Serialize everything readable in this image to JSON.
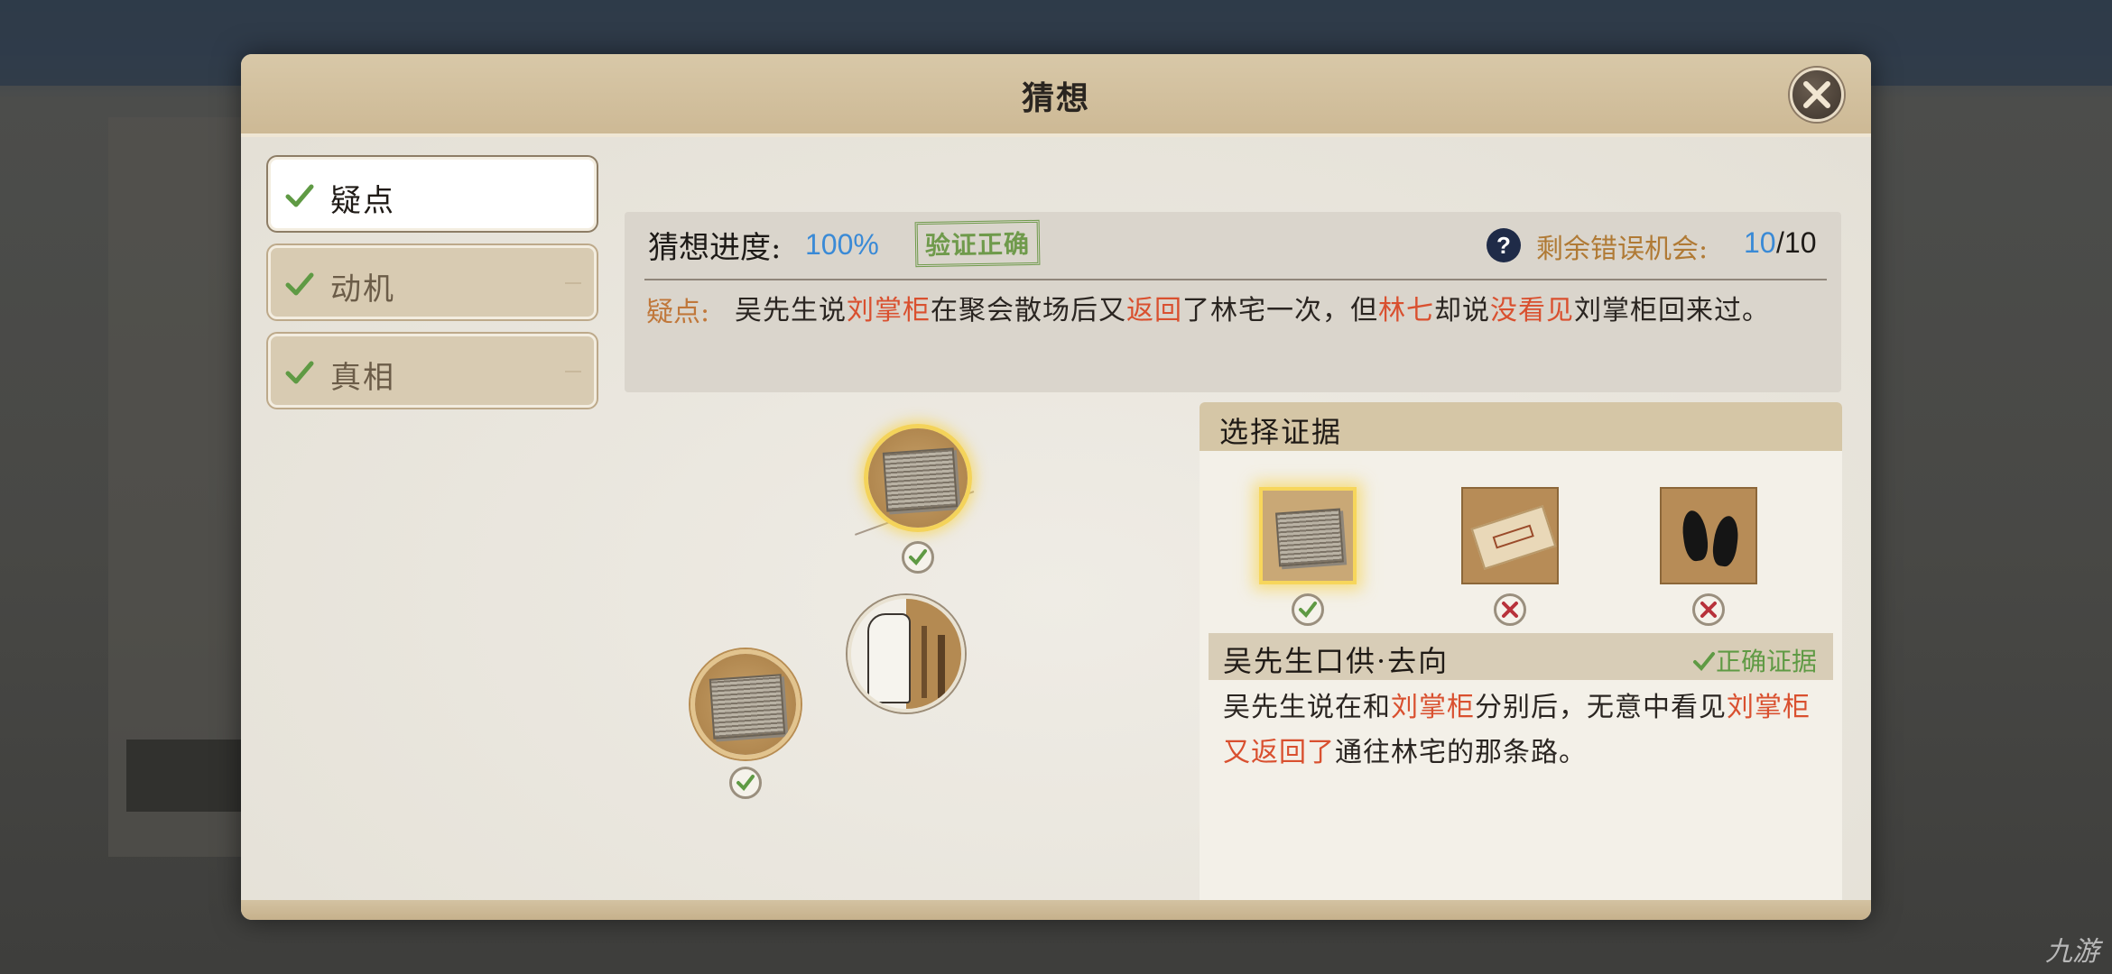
{
  "dialog": {
    "title": "猜想"
  },
  "tabs": [
    {
      "label": "疑点",
      "active": true
    },
    {
      "label": "动机",
      "active": false
    },
    {
      "label": "真相",
      "active": false
    }
  ],
  "progress": {
    "label": "猜想进度:",
    "value": "100%",
    "stamp": "验证正确",
    "help_icon": "?",
    "chances_label": "剩余错误机会:",
    "chances_left": "10",
    "chances_total": "/10"
  },
  "doubt": {
    "label": "疑点:",
    "parts": [
      "吴先生说",
      "刘掌柜",
      "在聚会散场后又",
      "返回",
      "了林宅一次，但",
      "林七",
      "却说",
      "没看见",
      "刘掌柜回来过。"
    ]
  },
  "evidence": {
    "title": "选择证据",
    "items": [
      {
        "icon": "ledger-icon",
        "state": "correct",
        "selected": true
      },
      {
        "icon": "ticket-icon",
        "state": "wrong",
        "selected": false
      },
      {
        "icon": "footprints-icon",
        "state": "wrong",
        "selected": false
      }
    ],
    "selected_name": "吴先生口供·去向",
    "correct_tag": "正确证据",
    "desc_parts": [
      "吴先生说在和",
      "刘掌柜",
      "分别后，无意中看见",
      "刘掌柜又返回了",
      "通往林宅的那条路。"
    ]
  },
  "graph": {
    "nodes": [
      {
        "icon": "ledger-icon",
        "state": "correct"
      },
      {
        "icon": "portrait-icon",
        "state": "center"
      },
      {
        "icon": "ledger-icon",
        "state": "correct"
      }
    ]
  },
  "watermark": "九游",
  "colors": {
    "accent_blue": "#3a8ad6",
    "highlight_red": "#d9502f",
    "ok_green": "#5f9a44",
    "label_orange": "#c0773a"
  }
}
